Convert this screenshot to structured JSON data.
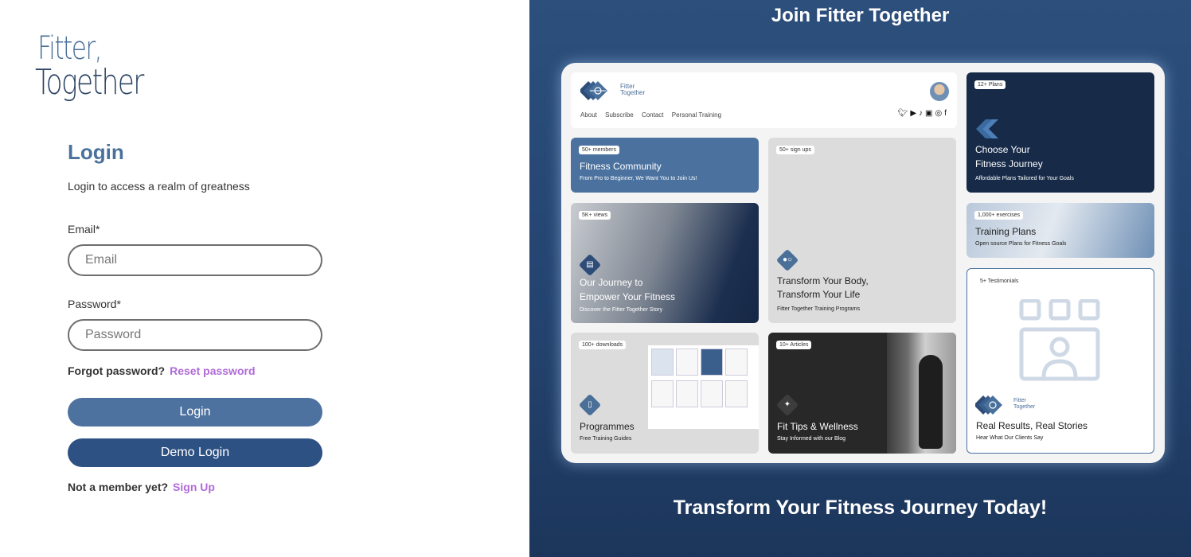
{
  "logo": {
    "line1": "Fitter,",
    "line2": "Together"
  },
  "login": {
    "title": "Login",
    "subtitle": "Login to access a realm of greatness",
    "email_label": "Email*",
    "email_placeholder": "Email",
    "email_value": "",
    "password_label": "Password*",
    "password_placeholder": "Password",
    "password_value": "",
    "forgot_text": "Forgot password?",
    "reset_link": "Reset password",
    "login_button": "Login",
    "demo_button": "Demo Login",
    "member_text": "Not a member yet?",
    "signup_link": "Sign Up"
  },
  "right": {
    "heading": "Join Fitter Together",
    "footer_heading": "Transform Your Fitness Journey Today!"
  },
  "preview": {
    "header": {
      "logo_text_1": "Fitter",
      "logo_text_2": "Together",
      "nav": [
        "About",
        "Subscribe",
        "Contact",
        "Personal Training"
      ],
      "socials": [
        "twitter-icon",
        "youtube-icon",
        "tiktok-icon",
        "linkedin-icon",
        "instagram-icon",
        "facebook-icon"
      ]
    },
    "cards": {
      "community": {
        "badge": "50+ members",
        "title": "Fitness Community",
        "sub": "From Pro to Beginner, We Want You to Join Us!"
      },
      "signups": {
        "badge": "50+ sign ups",
        "title_1": "Transform Your Body,",
        "title_2": "Transform Your Life",
        "sub": "Fitter Together Training Programs"
      },
      "plans": {
        "badge": "12+ Plans",
        "title_1": "Choose Your",
        "title_2": "Fitness Journey",
        "sub": "Affordable Plans Tailored for Your Goals"
      },
      "journey": {
        "badge": "5K+ views",
        "title_1": "Our Journey to",
        "title_2": "Empower Your Fitness",
        "sub": "Discover the Fitter Together Story"
      },
      "training": {
        "badge": "1,000+ exercises",
        "title": "Training Plans",
        "sub": "Open source Plans for Fitness Goals"
      },
      "testimonials": {
        "badge": "5+ Testimonials",
        "logo_text_1": "Fitter",
        "logo_text_2": "Together",
        "title": "Real Results, Real Stories",
        "sub": "Hear What Our Clients Say"
      },
      "programmes": {
        "badge": "100+ downloads",
        "title": "Programmes",
        "sub": "Free Training Guides"
      },
      "tips": {
        "badge": "10+ Articles",
        "title": "Fit Tips & Wellness",
        "sub": "Stay Informed with our Blog"
      }
    }
  },
  "colors": {
    "brand": "#4a719c",
    "brand_dark": "#2d5183",
    "link": "#b06ad8",
    "panel_bg": "#244470"
  }
}
